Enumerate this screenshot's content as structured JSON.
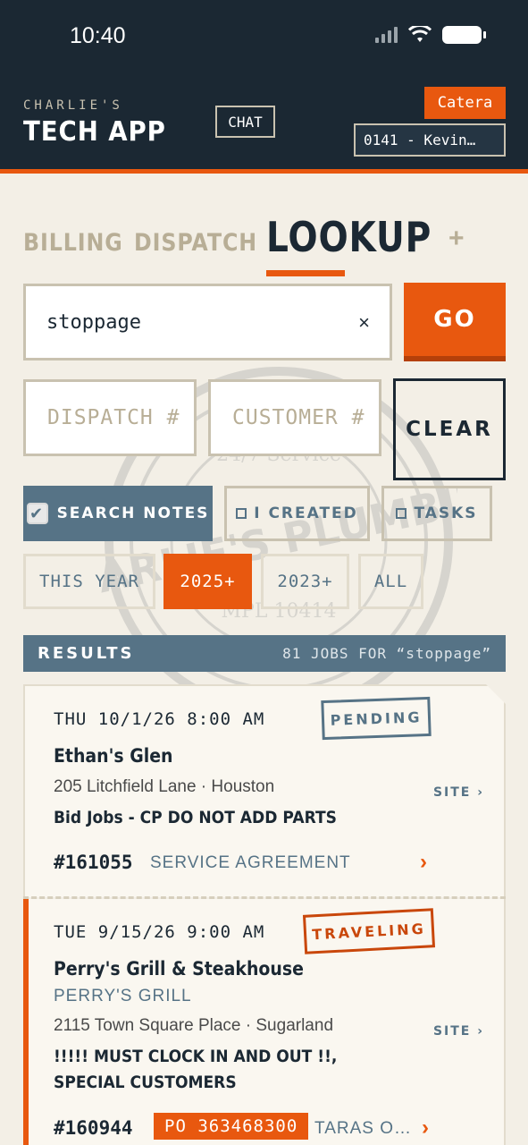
{
  "status_bar": {
    "time": "10:40"
  },
  "header": {
    "brand_small": "CHARLIE'S",
    "brand_big": "TECH APP",
    "chat_label": "CHAT",
    "company_badge": "Catera",
    "tech_selector": "0141 - Kevin…"
  },
  "watermark": {
    "line1": "CHARLIE'S PLUMBING",
    "line2": "24/7 Service",
    "line3": "MPL 10414"
  },
  "tabs": {
    "billing": "BILLING",
    "dispatch": "DISPATCH",
    "lookup": "LOOKUP",
    "add": "+"
  },
  "search": {
    "query": "stoppage",
    "clear_glyph": "×",
    "go_label": "GO",
    "dispatch_placeholder": "DISPATCH #",
    "customer_placeholder": "CUSTOMER #",
    "clear_label": "CLEAR"
  },
  "filters": {
    "search_notes": "SEARCH NOTES",
    "i_created": "I CREATED",
    "tasks": "TASKS",
    "periods": [
      "THIS YEAR",
      "2025+",
      "2023+",
      "ALL"
    ],
    "selected_period": "2025+"
  },
  "results": {
    "title": "RESULTS",
    "count_text": "81 JOBS FOR “stoppage”"
  },
  "jobs": [
    {
      "date": "THU 10/1/26 8:00 AM",
      "status": "PENDING",
      "name": "Ethan's Glen",
      "address": "205 Litchfield Lane · Houston",
      "site_label": "SITE ›",
      "note": "Bid Jobs - CP DO NOT ADD PARTS",
      "number": "#161055",
      "type": "SERVICE AGREEMENT",
      "arrow": "›"
    },
    {
      "date": "TUE 9/15/26 9:00 AM",
      "status": "TRAVELING",
      "name": "Perry's Grill & Steakhouse",
      "subname": "PERRY'S GRILL",
      "address": "2115 Town Square Place · Sugarland",
      "site_label": "SITE ›",
      "note": "!!!!! MUST CLOCK IN AND OUT !!, SPECIAL CUSTOMERS",
      "number": "#160944",
      "po": "PO 363468300",
      "type": "TARAS O…",
      "arrow": "›"
    }
  ]
}
